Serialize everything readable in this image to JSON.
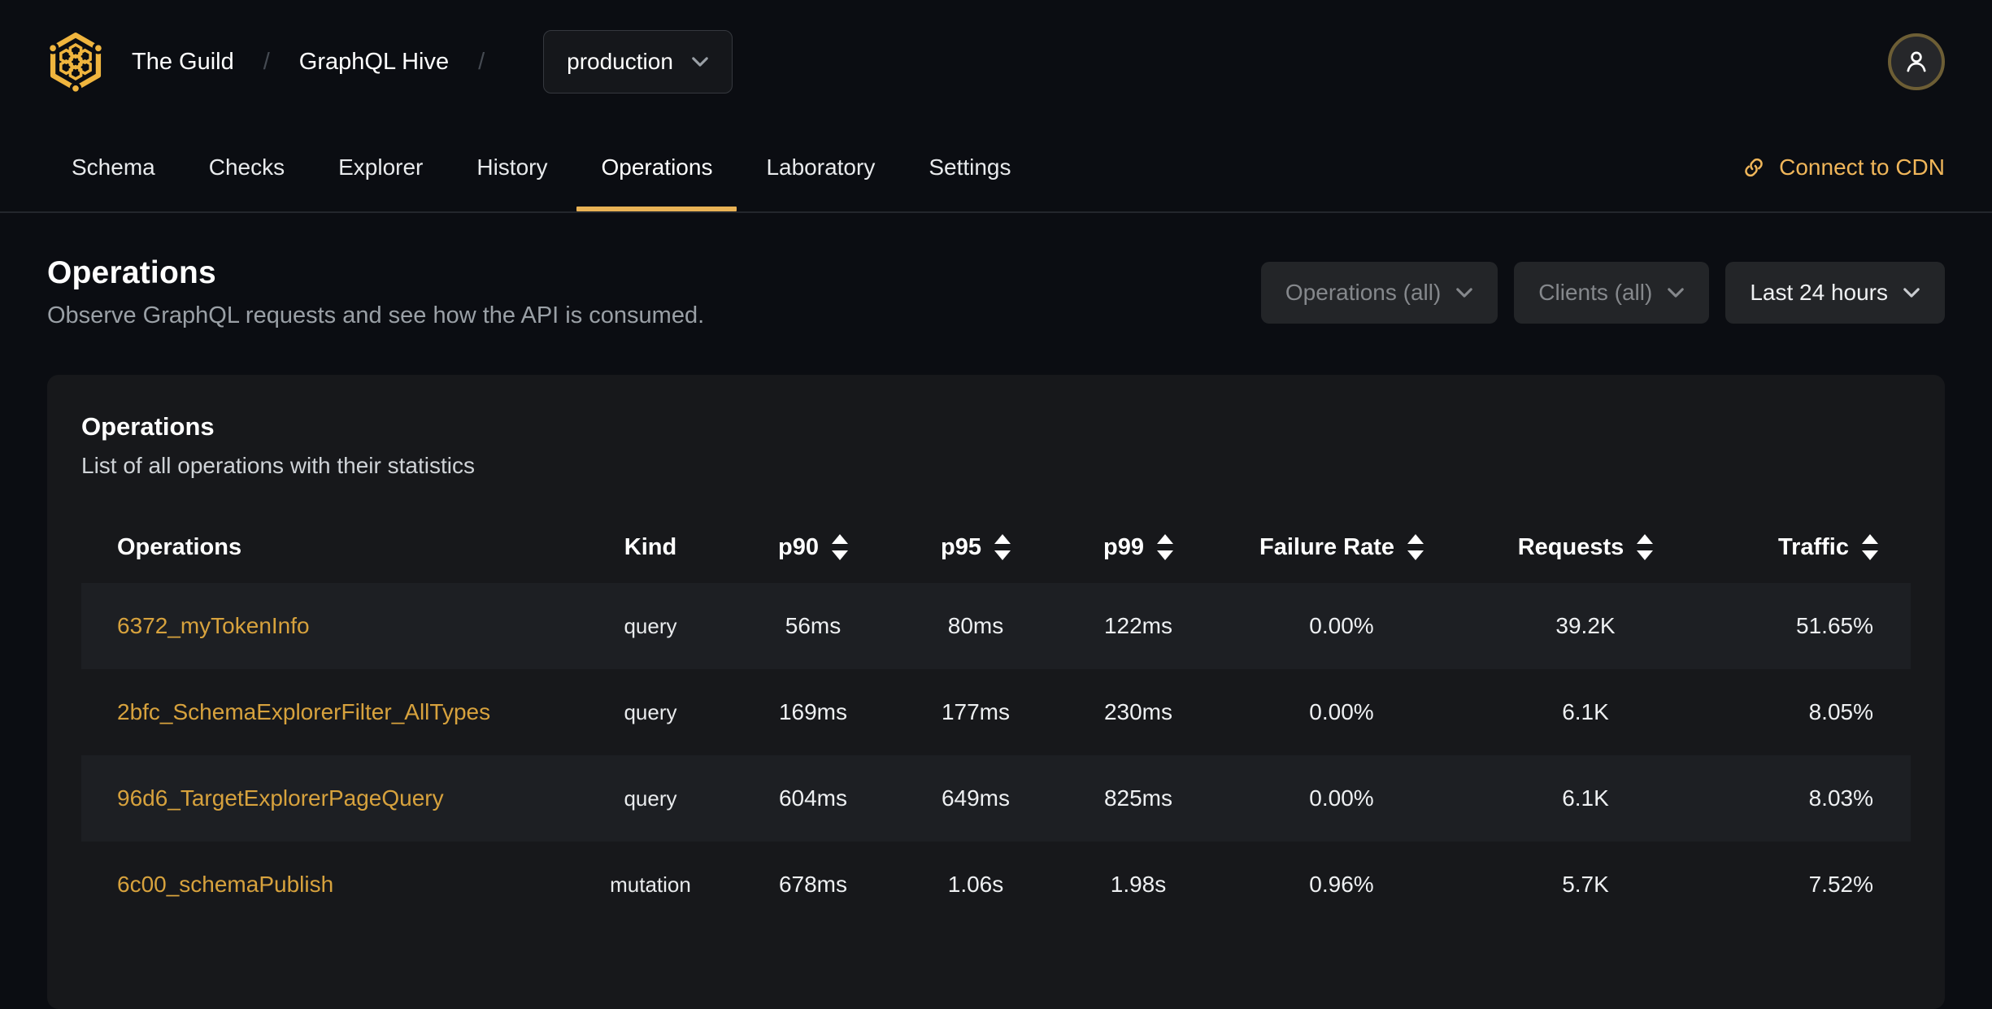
{
  "colors": {
    "accent_gold": "#f4b740",
    "tab_underline": "#e9b255",
    "operation_link": "#d7a23d",
    "page_background": "#0b0d12",
    "card_background": "#17181b",
    "row_stripe": "#1d1f23"
  },
  "topbar": {
    "org": "The Guild",
    "separator": "/",
    "product": "GraphQL Hive",
    "target_selector": {
      "value": "production"
    }
  },
  "nav": {
    "tabs": [
      {
        "label": "Schema",
        "active": false
      },
      {
        "label": "Checks",
        "active": false
      },
      {
        "label": "Explorer",
        "active": false
      },
      {
        "label": "History",
        "active": false
      },
      {
        "label": "Operations",
        "active": true
      },
      {
        "label": "Laboratory",
        "active": false
      },
      {
        "label": "Settings",
        "active": false
      }
    ],
    "cdn_link": {
      "label": "Connect to CDN"
    }
  },
  "page_header": {
    "title": "Operations",
    "subtitle": "Observe GraphQL requests and see how the API is consumed."
  },
  "filters": {
    "operations": {
      "label": "Operations (all)",
      "enabled": false
    },
    "clients": {
      "label": "Clients (all)",
      "enabled": false
    },
    "period": {
      "label": "Last 24 hours",
      "enabled": true
    }
  },
  "card": {
    "title": "Operations",
    "subtitle": "List of all operations with their statistics"
  },
  "table": {
    "columns": [
      {
        "key": "operation",
        "label": "Operations",
        "sortable": false,
        "align": "left"
      },
      {
        "key": "kind",
        "label": "Kind",
        "sortable": false,
        "align": "center"
      },
      {
        "key": "p90",
        "label": "p90",
        "sortable": true,
        "align": "center"
      },
      {
        "key": "p95",
        "label": "p95",
        "sortable": true,
        "align": "center"
      },
      {
        "key": "p99",
        "label": "p99",
        "sortable": true,
        "align": "center"
      },
      {
        "key": "failure_rate",
        "label": "Failure Rate",
        "sortable": true,
        "align": "center"
      },
      {
        "key": "requests",
        "label": "Requests",
        "sortable": true,
        "align": "center"
      },
      {
        "key": "traffic",
        "label": "Traffic",
        "sortable": true,
        "align": "right"
      }
    ],
    "rows": [
      {
        "operation": "6372_myTokenInfo",
        "kind": "query",
        "p90": "56ms",
        "p95": "80ms",
        "p99": "122ms",
        "failure_rate": "0.00%",
        "requests": "39.2K",
        "traffic": "51.65%"
      },
      {
        "operation": "2bfc_SchemaExplorerFilter_AllTypes",
        "kind": "query",
        "p90": "169ms",
        "p95": "177ms",
        "p99": "230ms",
        "failure_rate": "0.00%",
        "requests": "6.1K",
        "traffic": "8.05%"
      },
      {
        "operation": "96d6_TargetExplorerPageQuery",
        "kind": "query",
        "p90": "604ms",
        "p95": "649ms",
        "p99": "825ms",
        "failure_rate": "0.00%",
        "requests": "6.1K",
        "traffic": "8.03%"
      },
      {
        "operation": "6c00_schemaPublish",
        "kind": "mutation",
        "p90": "678ms",
        "p95": "1.06s",
        "p99": "1.98s",
        "failure_rate": "0.96%",
        "requests": "5.7K",
        "traffic": "7.52%"
      }
    ]
  }
}
